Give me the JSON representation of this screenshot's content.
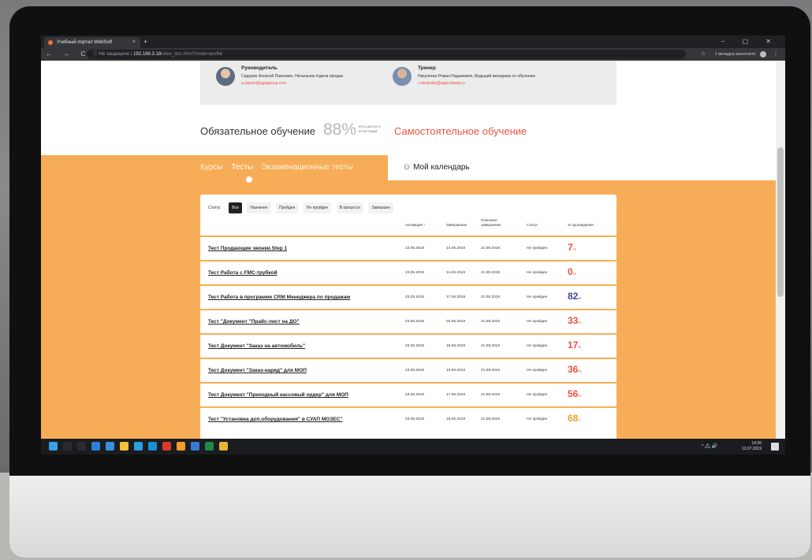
{
  "browser": {
    "tab_title": "Учебный портал WebSoft",
    "new_tab": "+",
    "close_tab": "×",
    "window_controls": "– ▢ ✕",
    "nav_buttons": "← → C",
    "security": "ⓘ Не защищено |",
    "host": "192.168.3.18",
    "path": "/view_doc.html?mode=profile",
    "incognito_label": "1 вкладка инкогнито",
    "menu": "⋮"
  },
  "staff": {
    "manager": {
      "role": "Руководитель",
      "name": "Сидорин Алексей Павлович, Начальник отдела продаж",
      "email": "a.sidorin@agatgroup.com"
    },
    "trainer": {
      "role": "Тренер",
      "name": "Никуленко Роман Надымович, Ведущий менеджер по обучению",
      "email": "r.nikulenko@agat-shada.ru"
    }
  },
  "heading": {
    "mandatory": "Обязательное обучение",
    "percent": "88%",
    "note": "есть доступ к аттестации",
    "self": "Самостоятельное обучение"
  },
  "subnav": {
    "courses": "Курсы",
    "tests": "Тесты",
    "exams": "Экзаменационные тесты",
    "calendar_icon": "calendar-icon",
    "calendar": "Мой календарь"
  },
  "filters": {
    "label": "Статус",
    "options": [
      "Все",
      "Назначен",
      "Пройден",
      "Не пройден",
      "В процессе",
      "Завершен"
    ],
    "active": "Все"
  },
  "table": {
    "headers": {
      "activation": "Активация ↑",
      "completion": "Завершение",
      "planned": "Плановое завершение",
      "status": "Статус",
      "progress": "% прохождения"
    },
    "rows": [
      {
        "name": "Тест Продающие звонки.Step 1",
        "activation": "23.05.2019",
        "completion": "14.06.2019",
        "planned": "21.08.2019",
        "status": "Не пройден",
        "percent": "7",
        "color": "#e8533f"
      },
      {
        "name": "Тест Работа с FMC-трубкой",
        "activation": "23.05.2019",
        "completion": "14.06.2019",
        "planned": "21.08.2019",
        "status": "Не пройден",
        "percent": "0",
        "color": "#e8533f"
      },
      {
        "name": "Тест Работа в программе CRM Менеджера по продажам",
        "activation": "23.05.2019",
        "completion": "17.06.2019",
        "planned": "21.08.2019",
        "status": "Не пройден",
        "percent": "82",
        "color": "#3b4a9a"
      },
      {
        "name": "Тест \"Документ \"Прайс-лист на ДО\"",
        "activation": "23.05.2019",
        "completion": "04.06.2019",
        "planned": "21.08.2019",
        "status": "Не пройден",
        "percent": "33",
        "color": "#e8533f"
      },
      {
        "name": "Тест Документ \"Заказ на автомобиль\"",
        "activation": "23.05.2019",
        "completion": "18.06.2019",
        "planned": "21.08.2019",
        "status": "Не пройден",
        "percent": "17",
        "color": "#e8533f"
      },
      {
        "name": "Тест Документ \"Заказ-наряд\" для МОП",
        "activation": "23.05.2019",
        "completion": "10.06.2019",
        "planned": "21.08.2019",
        "status": "Не пройден",
        "percent": "36",
        "color": "#e8533f"
      },
      {
        "name": "Тест Документ \"Приходный кассовый ордер\" для МОП",
        "activation": "23.05.2019",
        "completion": "17.06.2019",
        "planned": "21.08.2019",
        "status": "Не пройден",
        "percent": "56",
        "color": "#e8533f"
      },
      {
        "name": "Тест \"Установка доп.оборудования\" в СУАП МОЗЕС\"",
        "activation": "23.05.2019",
        "completion": "18.06.2019",
        "planned": "21.08.2019",
        "status": "Не пройден",
        "percent": "68",
        "color": "#f0a030"
      }
    ],
    "percent_sign": "%"
  },
  "taskbar": {
    "time": "14:36",
    "date": "12.07.2019",
    "tray": "^ 🖧 🔊",
    "apps": [
      {
        "icon": "windows-start-icon",
        "color": "#3aa0e8"
      },
      {
        "icon": "search-icon",
        "color": "#2a2b30"
      },
      {
        "icon": "task-view-icon",
        "color": "#2a2b30"
      },
      {
        "icon": "edge-icon",
        "color": "#2e7fd9"
      },
      {
        "icon": "store-icon",
        "color": "#3a8de0"
      },
      {
        "icon": "files-icon",
        "color": "#f3c03a"
      },
      {
        "icon": "skype-icon",
        "color": "#2aa0e0"
      },
      {
        "icon": "skype2-icon",
        "color": "#1b8fd8"
      },
      {
        "icon": "app-red-icon",
        "color": "#d83a2e"
      },
      {
        "icon": "app-orange-icon",
        "color": "#f29b2b"
      },
      {
        "icon": "app-grid-icon",
        "color": "#3c78d8"
      },
      {
        "icon": "excel-icon",
        "color": "#1f8a47"
      },
      {
        "icon": "chrome-icon",
        "color": "#e6b32e"
      }
    ]
  }
}
